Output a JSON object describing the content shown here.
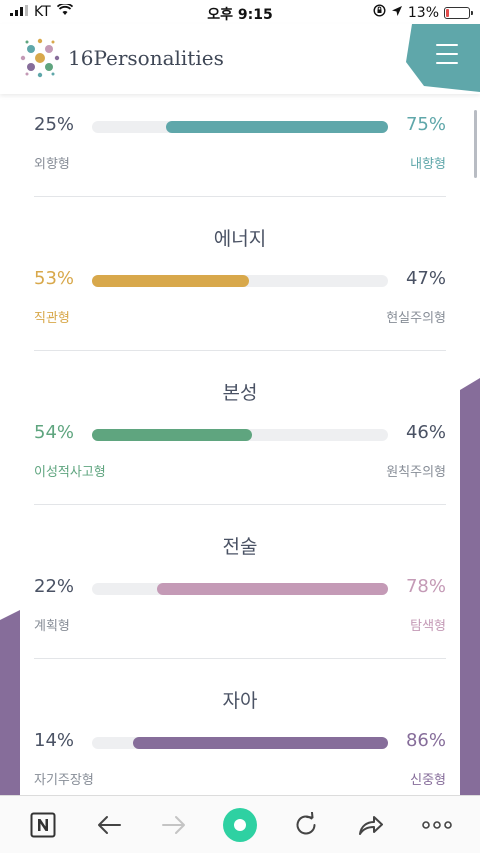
{
  "status_bar": {
    "carrier": "KT",
    "time": "오후 9:15",
    "battery": "13%",
    "battery_level": 0.13
  },
  "header": {
    "logo_text": "16Personalities",
    "menu_icon": "hamburger-menu-icon"
  },
  "colors": {
    "teal": "#5fa7aa",
    "yellow": "#d8a84b",
    "green": "#5fa57f",
    "pink": "#c49ab6",
    "purple": "#866d9a",
    "bar_bg": "#eeeff1"
  },
  "traits": [
    {
      "title": "",
      "left_pct": "25%",
      "right_pct": "75%",
      "left_label": "외향형",
      "right_label": "내향형",
      "dominant": "right",
      "color": "#5fa7aa",
      "value": 75
    },
    {
      "title": "에너지",
      "left_pct": "53%",
      "right_pct": "47%",
      "left_label": "직관형",
      "right_label": "현실주의형",
      "dominant": "left",
      "color": "#d8a84b",
      "value": 53
    },
    {
      "title": "본성",
      "left_pct": "54%",
      "right_pct": "46%",
      "left_label": "이성적사고형",
      "right_label": "원칙주의형",
      "dominant": "left",
      "color": "#5fa57f",
      "value": 54
    },
    {
      "title": "전술",
      "left_pct": "22%",
      "right_pct": "78%",
      "left_label": "계획형",
      "right_label": "탐색형",
      "dominant": "right",
      "color": "#c49ab6",
      "value": 78
    },
    {
      "title": "자아",
      "left_pct": "14%",
      "right_pct": "86%",
      "left_label": "자기주장형",
      "right_label": "신중형",
      "dominant": "right",
      "color": "#866d9a",
      "value": 86
    }
  ],
  "bottom_bar": {
    "items": [
      "naver-n-icon",
      "back-arrow-icon",
      "forward-arrow-icon",
      "home-circle-icon",
      "reload-icon",
      "share-icon",
      "more-dots-icon"
    ]
  }
}
